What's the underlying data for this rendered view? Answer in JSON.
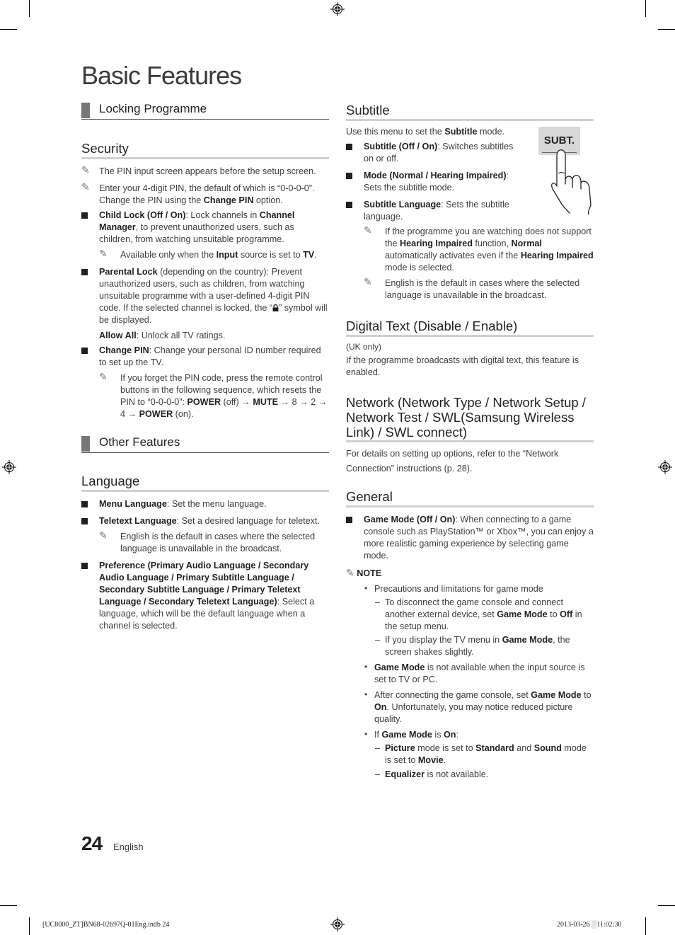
{
  "page": {
    "title": "Basic Features",
    "page_number": "24",
    "language": "English"
  },
  "slug": {
    "file": "[UC8000_ZT]BN68-02697Q-01Eng.indb   24",
    "date": "2013-03-26",
    "time_icon": "░",
    "time": "11:02:30"
  },
  "left": {
    "locking_chapter": "Locking Programme",
    "security": {
      "heading": "Security",
      "note1": "The PIN input screen appears before the setup screen.",
      "note2": "Enter your 4-digit PIN, the default of which is “0-0-0-0”. Change the PIN using the ",
      "note2_b": "Change PIN",
      "note2_end": " option.",
      "child_lock_b": "Child Lock (Off / On)",
      "child_lock_1": ": Lock channels in ",
      "child_lock_b2": "Channel Manager",
      "child_lock_2": ", to prevent unauthorized users, such as children, from watching unsuitable programme.",
      "child_note_1": "Available only when the ",
      "child_note_b": "Input",
      "child_note_2": " source is set to ",
      "child_note_b2": "TV",
      "child_note_3": ".",
      "parental_b": "Parental Lock",
      "parental_1": " (depending on the country): Prevent unauthorized users, such as children, from watching unsuitable programme with a user-defined 4-digit PIN code. If the selected channel is locked, the “",
      "parental_2": "” symbol will be displayed.",
      "allow_all_b": "Allow All",
      "allow_all": ": Unlock all TV ratings.",
      "change_pin_b": "Change PIN",
      "change_pin": ": Change your personal ID number required to set up the TV.",
      "forget_1": "If you forget the PIN code, press the remote control buttons in the following sequence, which resets the PIN to “0-0-0-0”: ",
      "forget_power": "POWER",
      "forget_2": " (off) → ",
      "forget_mute": "MUTE",
      "forget_3": " → 8 → 2 → 4 → ",
      "forget_power2": "POWER",
      "forget_4": " (on)."
    },
    "other_chapter": "Other Features",
    "language": {
      "heading": "Language",
      "menu_b": "Menu Language",
      "menu": ": Set the menu language.",
      "teletext_b": "Teletext Language",
      "teletext": ": Set a desired language for teletext.",
      "teletext_note": "English is the default in cases where the selected language is unavailable in the broadcast.",
      "pref_b": "Preference (Primary Audio Language / Secondary Audio Language / Primary Subtitle Language / Secondary Subtitle Language / Primary Teletext Language / Secondary Teletext Language)",
      "pref": ": Select a language, which will be the default language when a channel is selected."
    }
  },
  "right": {
    "subtitle": {
      "heading": "Subtitle",
      "intro_1": "Use this menu to set the ",
      "intro_b": "Subtitle",
      "intro_2": " mode.",
      "button_label": "SUBT.",
      "item1_b": "Subtitle (Off / On)",
      "item1": ": Switches subtitles on or off.",
      "item2_b": "Mode (Normal / Hearing Impaired)",
      "item2": ": Sets the subtitle mode.",
      "item3_b": "Subtitle Language",
      "item3": ": Sets the subtitle language.",
      "note1_1": "If the programme you are watching does not support the ",
      "note1_b1": "Hearing Impaired",
      "note1_2": " function, ",
      "note1_b2": "Normal",
      "note1_3": " automatically activates even if the ",
      "note1_b3": "Hearing Impaired",
      "note1_4": " mode is selected.",
      "note2": "English is the default in cases where the selected language is unavailable in the broadcast."
    },
    "digital_text": {
      "heading": "Digital Text (Disable / Enable)",
      "line1": "(UK only)",
      "line2": "If the programme broadcasts with digital text, this feature is enabled."
    },
    "network": {
      "heading": "Network (Network Type / Network Setup / Network Test / SWL(Samsung Wireless Link) / SWL connect)",
      "body": "For details on setting up options, refer to the “Network Connection” instructions (p. 28)."
    },
    "general": {
      "heading": "General",
      "game_b": "Game Mode (Off / On)",
      "game": ": When connecting to a game console such as PlayStation™ or Xbox™, you can enjoy a more realistic gaming experience by selecting game mode.",
      "note_label": "NOTE",
      "b1": "Precautions and limitations for game mode",
      "d1_1": "To disconnect the game console and connect another external device, set ",
      "d1_b1": "Game Mode",
      "d1_2": " to ",
      "d1_b2": "Off",
      "d1_3": " in the setup menu.",
      "d2_1": "If you display the TV menu in ",
      "d2_b": "Game Mode",
      "d2_2": ", the screen shakes slightly.",
      "b2_b": "Game Mode",
      "b2": " is not available when the input source is set to TV or PC.",
      "b3_1": "After connecting the game console, set ",
      "b3_b1": "Game Mode",
      "b3_2": " to ",
      "b3_b2": "On",
      "b3_3": ". Unfortunately, you may notice reduced picture quality.",
      "b4_1": "If ",
      "b4_b1": "Game Mode",
      "b4_2": " is ",
      "b4_b2": "On",
      "b4_3": ":",
      "d3_b1": "Picture",
      "d3_1": " mode is set to ",
      "d3_b2": "Standard",
      "d3_2": " and ",
      "d3_b3": "Sound",
      "d3_3": " mode is set to ",
      "d3_b4": "Movie",
      "d3_4": ".",
      "d4_b": "Equalizer",
      "d4": " is not available."
    }
  }
}
